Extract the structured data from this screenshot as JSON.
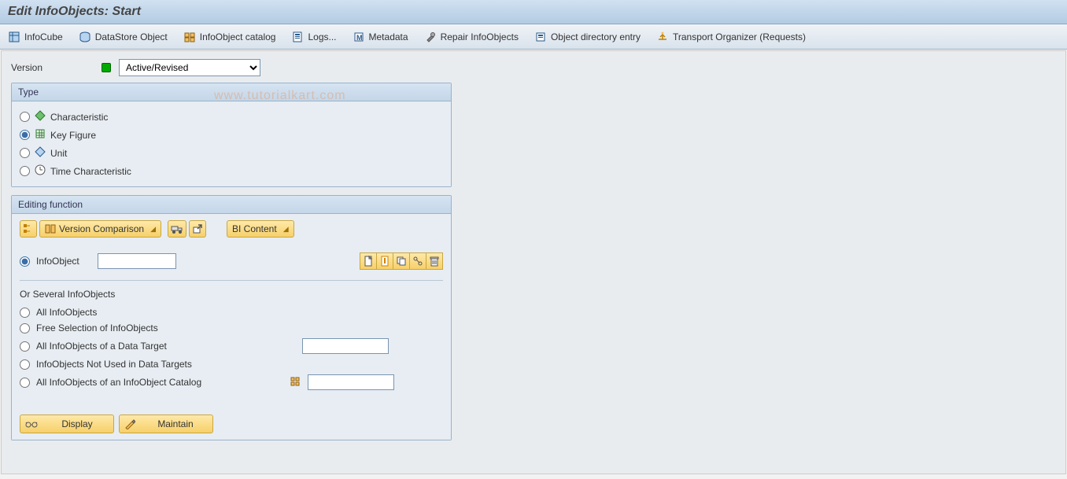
{
  "title": "Edit InfoObjects: Start",
  "toolbar": [
    {
      "label": "InfoCube"
    },
    {
      "label": "DataStore Object"
    },
    {
      "label": "InfoObject catalog"
    },
    {
      "label": "Logs..."
    },
    {
      "label": "Metadata"
    },
    {
      "label": "Repair InfoObjects"
    },
    {
      "label": "Object directory entry"
    },
    {
      "label": "Transport Organizer (Requests)"
    }
  ],
  "version": {
    "label": "Version",
    "selected": "Active/Revised"
  },
  "type_group": {
    "title": "Type",
    "options": [
      "Characteristic",
      "Key Figure",
      "Unit",
      "Time Characteristic"
    ],
    "selected": 1
  },
  "editing_group": {
    "title": "Editing function",
    "version_comparison": "Version Comparison",
    "bi_content": "BI Content",
    "infoobject_label": "InfoObject",
    "or_several_label": "Or Several InfoObjects",
    "sub_options": [
      "All InfoObjects",
      "Free Selection of InfoObjects",
      "All InfoObjects of a Data Target",
      "InfoObjects Not Used in Data Targets",
      "All InfoObjects of an InfoObject Catalog"
    ],
    "display_btn": "Display",
    "maintain_btn": "Maintain"
  },
  "watermark": "www.tutorialkart.com"
}
